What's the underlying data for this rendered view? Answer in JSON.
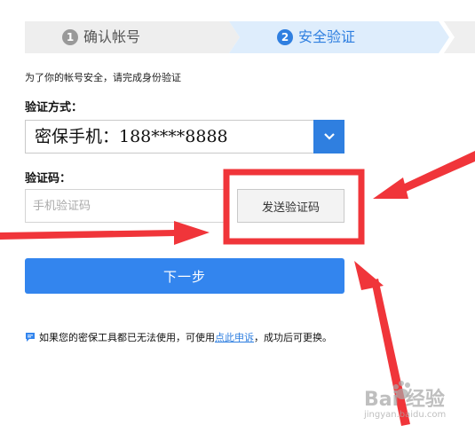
{
  "steps": [
    {
      "num": "1",
      "label": "确认帐号"
    },
    {
      "num": "2",
      "label": "安全验证"
    }
  ],
  "notice": "为了你的帐号安全，请完成身份验证",
  "method": {
    "label": "验证方式：",
    "selected": "密保手机：188****8888"
  },
  "code": {
    "label": "验证码：",
    "placeholder": "手机验证码",
    "send_label": "发送验证码"
  },
  "next_label": "下一步",
  "help": {
    "prefix": "如果您的密保工具都已无法使用，可使用",
    "link": "点此申诉",
    "suffix": "，成功后可更换。"
  },
  "watermark": {
    "main": "Bai 经验",
    "sub": "jingyan.baidu.com"
  },
  "colors": {
    "accent": "#2f7fe0",
    "annotation": "#f0353a"
  },
  "icons": {
    "help": "chat-bubble-icon",
    "dropdown": "chevron-down-icon",
    "paw": "paw-icon"
  }
}
